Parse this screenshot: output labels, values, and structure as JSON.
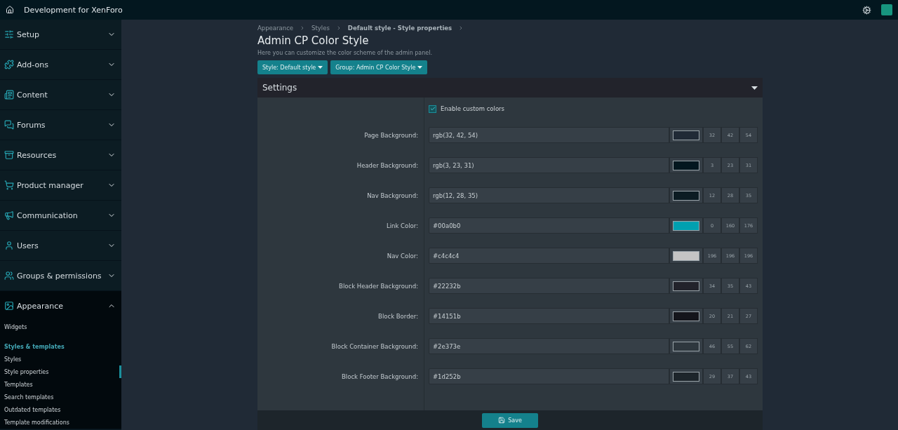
{
  "header": {
    "title": "Development for XenForo"
  },
  "sidebar": {
    "sections": [
      {
        "label": "Setup",
        "expanded": false
      },
      {
        "label": "Add-ons",
        "expanded": false
      },
      {
        "label": "Content",
        "expanded": false
      },
      {
        "label": "Forums",
        "expanded": false
      },
      {
        "label": "Resources",
        "expanded": false
      },
      {
        "label": "Product manager",
        "expanded": false
      },
      {
        "label": "Communication",
        "expanded": false
      },
      {
        "label": "Users",
        "expanded": false
      },
      {
        "label": "Groups & permissions",
        "expanded": false
      },
      {
        "label": "Appearance",
        "expanded": true,
        "children": [
          {
            "kind": "link",
            "label": "Widgets",
            "selected": false
          },
          {
            "kind": "heading",
            "label": "Styles & templates"
          },
          {
            "kind": "link",
            "label": "Styles",
            "selected": false
          },
          {
            "kind": "link",
            "label": "Style properties",
            "selected": true
          },
          {
            "kind": "link",
            "label": "Templates",
            "selected": false
          },
          {
            "kind": "link",
            "label": "Search templates",
            "selected": false
          },
          {
            "kind": "link",
            "label": "Outdated templates",
            "selected": false
          },
          {
            "kind": "link",
            "label": "Template modifications",
            "selected": false
          }
        ]
      }
    ]
  },
  "breadcrumb": [
    {
      "label": "Appearance",
      "current": false
    },
    {
      "label": "Styles",
      "current": false
    },
    {
      "label": "Default style - Style properties",
      "current": true
    }
  ],
  "page": {
    "title": "Admin CP Color Style",
    "description": "Here you can customize the color scheme of the admin panel."
  },
  "filters": [
    "Style: Default style",
    "Group: Admin CP Color Style"
  ],
  "settings": {
    "title": "Settings",
    "expanded": true,
    "enable": {
      "label": "Enable custom colors",
      "checked": true
    },
    "rows": [
      {
        "label": "Page Background:",
        "value": "rgb(32, 42, 54)",
        "color": "#202a36",
        "rgb": [
          "32",
          "42",
          "54"
        ]
      },
      {
        "label": "Header Background:",
        "value": "rgb(3, 23, 31)",
        "color": "#03171f",
        "rgb": [
          "3",
          "23",
          "31"
        ]
      },
      {
        "label": "Nav Background:",
        "value": "rgb(12, 28, 35)",
        "color": "#0c1c23",
        "rgb": [
          "12",
          "28",
          "35"
        ]
      },
      {
        "label": "Link Color:",
        "value": "#00a0b0",
        "color": "#00a0b0",
        "rgb": [
          "0",
          "160",
          "176"
        ]
      },
      {
        "label": "Nav Color:",
        "value": "#c4c4c4",
        "color": "#c4c4c4",
        "rgb": [
          "196",
          "196",
          "196"
        ]
      },
      {
        "label": "Block Header Background:",
        "value": "#22232b",
        "color": "#22232b",
        "rgb": [
          "34",
          "35",
          "43"
        ]
      },
      {
        "label": "Block Border:",
        "value": "#14151b",
        "color": "#14151b",
        "rgb": [
          "20",
          "21",
          "27"
        ]
      },
      {
        "label": "Block Container Background:",
        "value": "#2e373e",
        "color": "#2e373e",
        "rgb": [
          "46",
          "55",
          "62"
        ]
      },
      {
        "label": "Block Footer Background:",
        "value": "#1d252b",
        "color": "#1d252b",
        "rgb": [
          "29",
          "37",
          "43"
        ]
      }
    ]
  },
  "save": "Save"
}
